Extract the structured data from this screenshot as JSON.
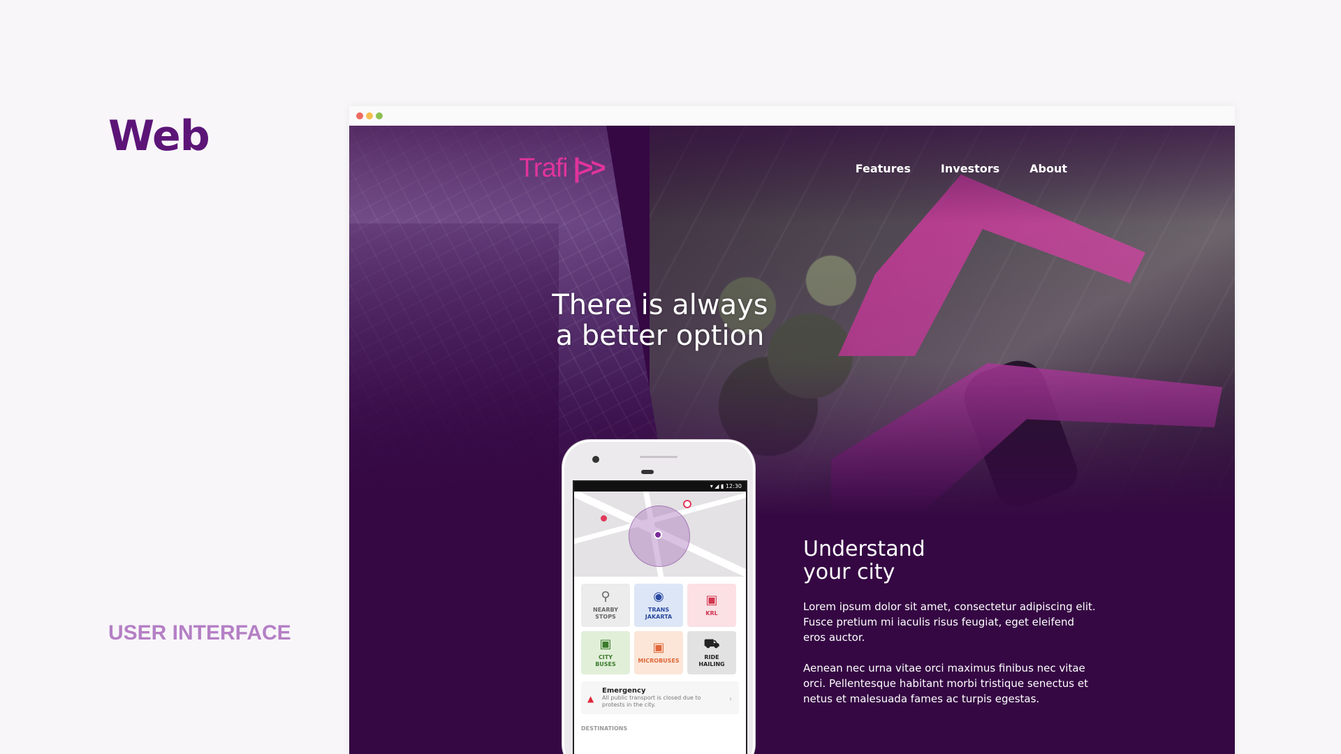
{
  "side": {
    "title": "Web",
    "caption": "USER INTERFACE"
  },
  "site": {
    "logo_text": "Trafi",
    "logo_mark": "|>>",
    "nav": [
      "Features",
      "Investors",
      "About"
    ],
    "hero_title_line1": "There is always",
    "hero_title_line2": "a better option",
    "section_title_line1": "Understand",
    "section_title_line2": "your city",
    "paragraph1": "Lorem ipsum dolor sit amet, consectetur adipiscing elit. Fusce pretium mi iaculis risus feugiat, eget eleifend eros auctor.",
    "paragraph2": "Aenean nec urna vitae orci maximus finibus nec vitae orci. Pellentesque habitant morbi tristique senectus et netus et malesuada fames ac turpis egestas."
  },
  "phone": {
    "status_time": "12:30",
    "tiles": [
      {
        "line1": "NEARBY",
        "line2": "STOPS",
        "icon": "pin-icon"
      },
      {
        "line1": "TRANS",
        "line2": "JAKARTA",
        "icon": "transjakarta-icon"
      },
      {
        "line1": "KRL",
        "line2": "",
        "icon": "train-icon"
      },
      {
        "line1": "CITY",
        "line2": "BUSES",
        "icon": "bus-icon"
      },
      {
        "line1": "MICROBUSES",
        "line2": "",
        "icon": "microbus-icon"
      },
      {
        "line1": "RIDE",
        "line2": "HAILING",
        "icon": "car-icon"
      }
    ],
    "alert_title": "Emergency",
    "alert_body": "All public transport is closed due to protests in the city.",
    "destinations_label": "DESTINATIONS"
  },
  "colors": {
    "brand_purple": "#5c1577",
    "caption_lilac": "#b47fc5",
    "site_background": "#350843",
    "logo_pink": "#e0349b"
  }
}
